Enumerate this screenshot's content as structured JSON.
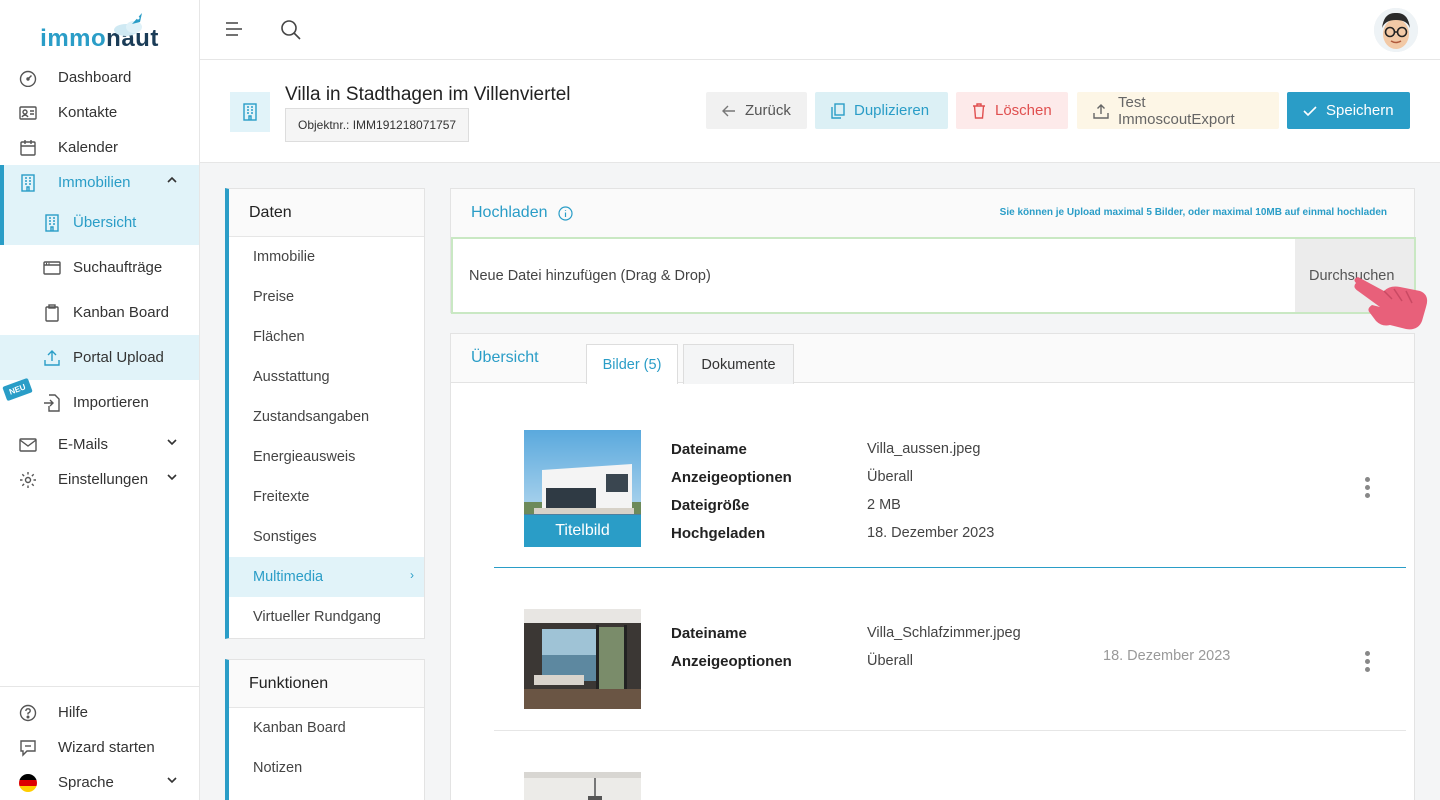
{
  "brand": {
    "name_light": "immo",
    "name_dark": "naut"
  },
  "sidebar": {
    "items": [
      {
        "label": "Dashboard"
      },
      {
        "label": "Kontakte"
      },
      {
        "label": "Kalender"
      },
      {
        "label": "Immobilien"
      },
      {
        "label": "Übersicht"
      },
      {
        "label": "Suchaufträge"
      },
      {
        "label": "Kanban Board"
      },
      {
        "label": "Portal Upload"
      },
      {
        "label": "Importieren",
        "badge": "NEU"
      },
      {
        "label": "E-Mails"
      },
      {
        "label": "Einstellungen"
      }
    ],
    "bottom": [
      {
        "label": "Hilfe"
      },
      {
        "label": "Wizard starten"
      },
      {
        "label": "Sprache"
      }
    ]
  },
  "header": {
    "title": "Villa in Stadthagen im Villenviertel",
    "object_nr": "Objektnr.: IMM191218071757",
    "buttons": {
      "back": "Zurück",
      "duplicate": "Duplizieren",
      "delete": "Löschen",
      "test_export": "Test ImmoscoutExport",
      "save": "Speichern"
    }
  },
  "daten_menu": {
    "title": "Daten",
    "items": [
      "Immobilie",
      "Preise",
      "Flächen",
      "Ausstattung",
      "Zustandsangaben",
      "Energieausweis",
      "Freitexte",
      "Sonstiges",
      "Multimedia",
      "Virtueller Rundgang"
    ],
    "active": "Multimedia"
  },
  "funktionen_menu": {
    "title": "Funktionen",
    "items": [
      "Kanban Board",
      "Notizen"
    ]
  },
  "upload": {
    "title": "Hochladen",
    "note": "Sie können je Upload maximal 5 Bilder, oder maximal 10MB auf einmal hochladen",
    "placeholder": "Neue Datei hinzufügen (Drag & Drop)",
    "browse": "Durchsuchen"
  },
  "overview": {
    "title": "Übersicht",
    "tabs": [
      "Bilder (5)",
      "Dokumente"
    ],
    "images": [
      {
        "caption": "Titelbild",
        "labels": [
          "Dateiname",
          "Anzeigeoptionen",
          "Dateigröße",
          "Hochgeladen"
        ],
        "values": [
          "Villa_aussen.jpeg",
          "Überall",
          "2 MB",
          "18. Dezember 2023"
        ]
      },
      {
        "labels": [
          "Dateiname",
          "Anzeigeoptionen"
        ],
        "values": [
          "Villa_Schlafzimmer.jpeg",
          "Überall"
        ],
        "date": "18. Dezember 2023"
      }
    ]
  },
  "colors": {
    "accent": "#2a9dc7",
    "danger": "#e04f4f",
    "drop_border": "#c9e8c3"
  },
  "language_flag": "de-flag-icon"
}
